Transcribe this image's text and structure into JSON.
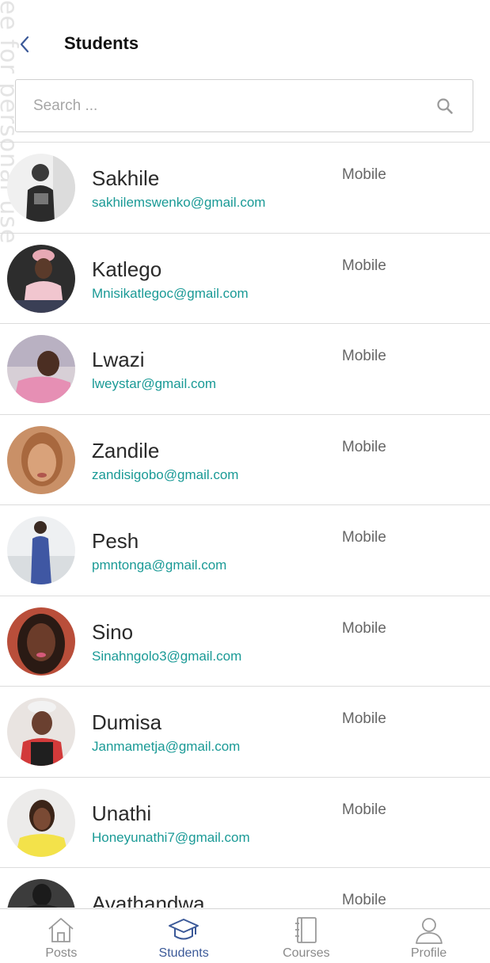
{
  "watermark": "ee for personal use",
  "header": {
    "title": "Students"
  },
  "search": {
    "placeholder": "Search ..."
  },
  "students": [
    {
      "name": "Sakhile",
      "email": "sakhilemswenko@gmail.com",
      "type": "Mobile"
    },
    {
      "name": "Katlego",
      "email": "Mnisikatlegoc@gmail.com",
      "type": "Mobile"
    },
    {
      "name": "Lwazi",
      "email": "lweystar@gmail.com",
      "type": "Mobile"
    },
    {
      "name": "Zandile",
      "email": "zandisigobo@gmail.com",
      "type": "Mobile"
    },
    {
      "name": "Pesh",
      "email": "pmntonga@gmail.com",
      "type": "Mobile"
    },
    {
      "name": "Sino",
      "email": "Sinahngolo3@gmail.com",
      "type": "Mobile"
    },
    {
      "name": "Dumisa",
      "email": "Janmametja@gmail.com",
      "type": "Mobile"
    },
    {
      "name": "Unathi",
      "email": "Honeyunathi7@gmail.com",
      "type": "Mobile"
    },
    {
      "name": "Avathandwa",
      "email": "",
      "type": "Mobile"
    }
  ],
  "tabs": [
    {
      "label": "Posts",
      "icon": "home-icon"
    },
    {
      "label": "Students",
      "icon": "graduation-cap-icon"
    },
    {
      "label": "Courses",
      "icon": "notebook-icon"
    },
    {
      "label": "Profile",
      "icon": "person-icon"
    }
  ],
  "colors": {
    "accent": "#3b5998",
    "email": "#1a9a96",
    "inactive_tab": "#8a8a8a",
    "divider": "#dcdcdc"
  }
}
